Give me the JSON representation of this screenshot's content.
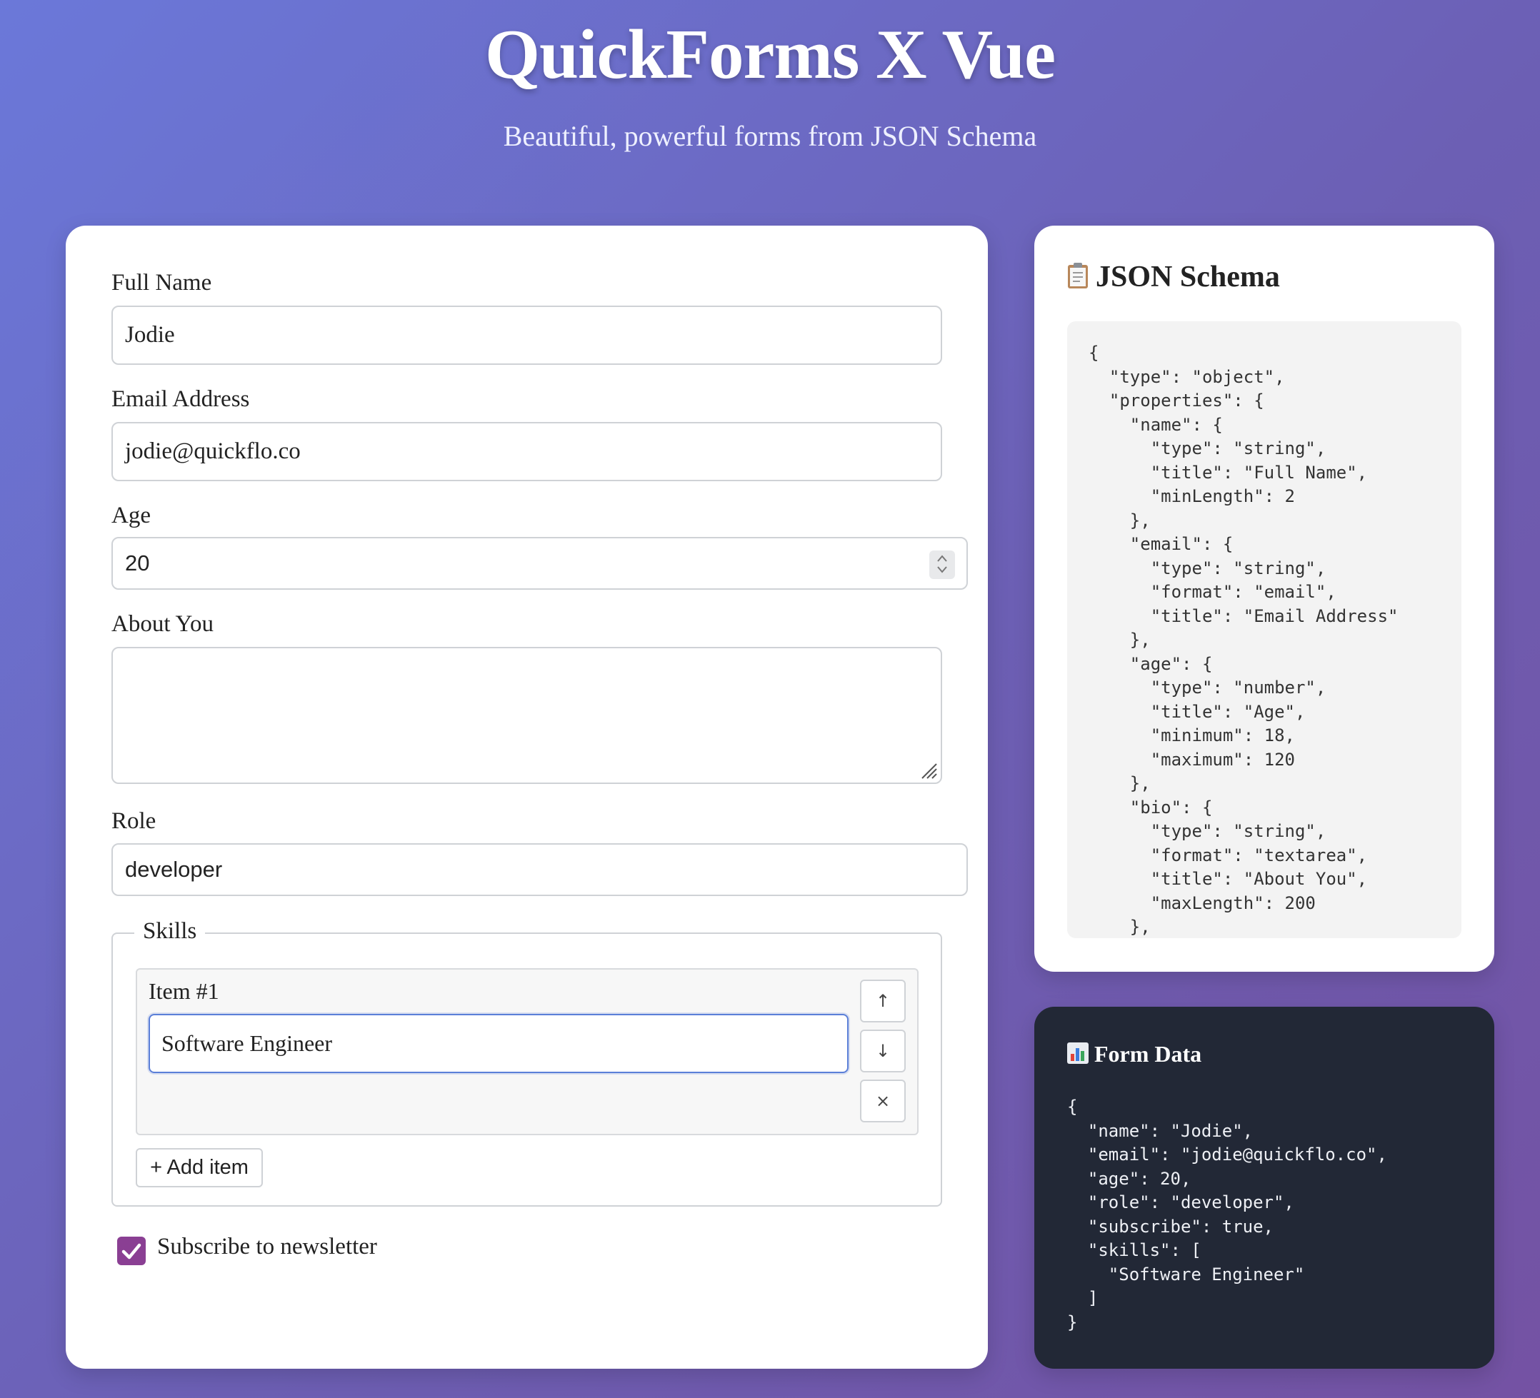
{
  "header": {
    "title": "QuickForms X Vue",
    "subtitle": "Beautiful, powerful forms from JSON Schema"
  },
  "form": {
    "name": {
      "label": "Full Name",
      "value": "Jodie"
    },
    "email": {
      "label": "Email Address",
      "value": "jodie@quickflo.co"
    },
    "age": {
      "label": "Age",
      "value": "20"
    },
    "bio": {
      "label": "About You",
      "value": ""
    },
    "role": {
      "label": "Role",
      "value": "developer"
    },
    "skills": {
      "legend": "Skills",
      "items": [
        {
          "label": "Item #1",
          "value": "Software Engineer"
        }
      ],
      "move_up_icon": "↑",
      "move_down_icon": "↓",
      "remove_icon": "×",
      "add_label": "+ Add item"
    },
    "subscribe": {
      "label": "Subscribe to newsletter",
      "checked": true
    }
  },
  "schema_panel": {
    "title": "JSON Schema",
    "icon": "clipboard-icon",
    "code": "{\n  \"type\": \"object\",\n  \"properties\": {\n    \"name\": {\n      \"type\": \"string\",\n      \"title\": \"Full Name\",\n      \"minLength\": 2\n    },\n    \"email\": {\n      \"type\": \"string\",\n      \"format\": \"email\",\n      \"title\": \"Email Address\"\n    },\n    \"age\": {\n      \"type\": \"number\",\n      \"title\": \"Age\",\n      \"minimum\": 18,\n      \"maximum\": 120\n    },\n    \"bio\": {\n      \"type\": \"string\",\n      \"format\": \"textarea\",\n      \"title\": \"About You\",\n      \"maxLength\": 200\n    },"
  },
  "data_panel": {
    "title": "Form Data",
    "icon": "bar-chart-icon",
    "code": "{\n  \"name\": \"Jodie\",\n  \"email\": \"jodie@quickflo.co\",\n  \"age\": 20,\n  \"role\": \"developer\",\n  \"subscribe\": true,\n  \"skills\": [\n    \"Software Engineer\"\n  ]\n}"
  },
  "colors": {
    "accent_checkbox": "#8a3f93",
    "focus_border": "#5b7fd8",
    "data_panel_bg": "#222836"
  }
}
